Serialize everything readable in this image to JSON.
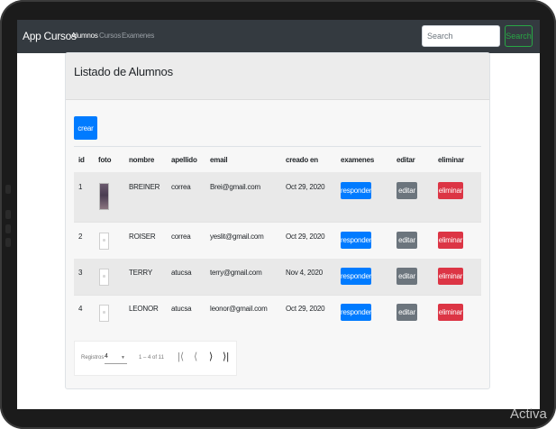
{
  "navbar": {
    "brand": "App Cursos",
    "links": [
      "Alumnos",
      "Cursos",
      "Examenes"
    ],
    "search_placeholder": "Search",
    "search_button": "Search"
  },
  "card": {
    "title": "Listado de Alumnos",
    "create_button": "crear"
  },
  "table": {
    "headers": [
      "id",
      "foto",
      "nombre",
      "apellido",
      "email",
      "creado en",
      "examenes",
      "editar",
      "eliminar"
    ],
    "rows": [
      {
        "id": "1",
        "has_photo": true,
        "nombre": "BREINER",
        "apellido": "correa",
        "email": "Brei@gmail.com",
        "creado": "Oct 29, 2020",
        "examenes": "responder",
        "editar": "editar",
        "eliminar": "eliminar"
      },
      {
        "id": "2",
        "has_photo": false,
        "nombre": "ROISER",
        "apellido": "correa",
        "email": "yeslit@gmail.com",
        "creado": "Oct 29, 2020",
        "examenes": "responder",
        "editar": "editar",
        "eliminar": "eliminar"
      },
      {
        "id": "3",
        "has_photo": false,
        "nombre": "TERRY",
        "apellido": "atucsa",
        "email": "terry@gmail.com",
        "creado": "Nov 4, 2020",
        "examenes": "responder",
        "editar": "editar",
        "eliminar": "eliminar"
      },
      {
        "id": "4",
        "has_photo": false,
        "nombre": "LEONOR",
        "apellido": "atucsa",
        "email": "leonor@gmail.com",
        "creado": "Oct 29, 2020",
        "examenes": "responder",
        "editar": "editar",
        "eliminar": "eliminar"
      }
    ]
  },
  "paginator": {
    "label": "Registros",
    "page_size": "4",
    "range": "1 – 4 of 11",
    "icons": [
      "first-page-icon",
      "prev-page-icon",
      "next-page-icon",
      "last-page-icon"
    ]
  },
  "watermark": "Activa",
  "colors": {
    "navbar": "#343a40",
    "primary": "#007bff",
    "secondary": "#6c757d",
    "danger": "#dc3545",
    "success": "#28a745"
  }
}
